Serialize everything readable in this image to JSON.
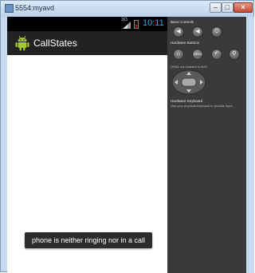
{
  "window": {
    "title": "5554:myavd"
  },
  "statusbar": {
    "network": "3G",
    "time": "10:11"
  },
  "app": {
    "title": "CallStates"
  },
  "toast": {
    "message": "phone is neither ringing nor in a call"
  },
  "controls": {
    "basic_label": "Basic Controls",
    "hardware_label": "Hardware Buttons",
    "dpad_label": "DPAD not enabled in AVD",
    "keyboard_label": "Hardware Keyboard",
    "keyboard_sub": "Use your physical keyboard to provide input",
    "menu_label": "MENU"
  },
  "colors": {
    "statusbar_bg": "#000000",
    "actionbar_bg": "#222222",
    "clock": "#35a6e6",
    "panel_bg": "#3a3a3a",
    "android_green": "#a4c639"
  }
}
